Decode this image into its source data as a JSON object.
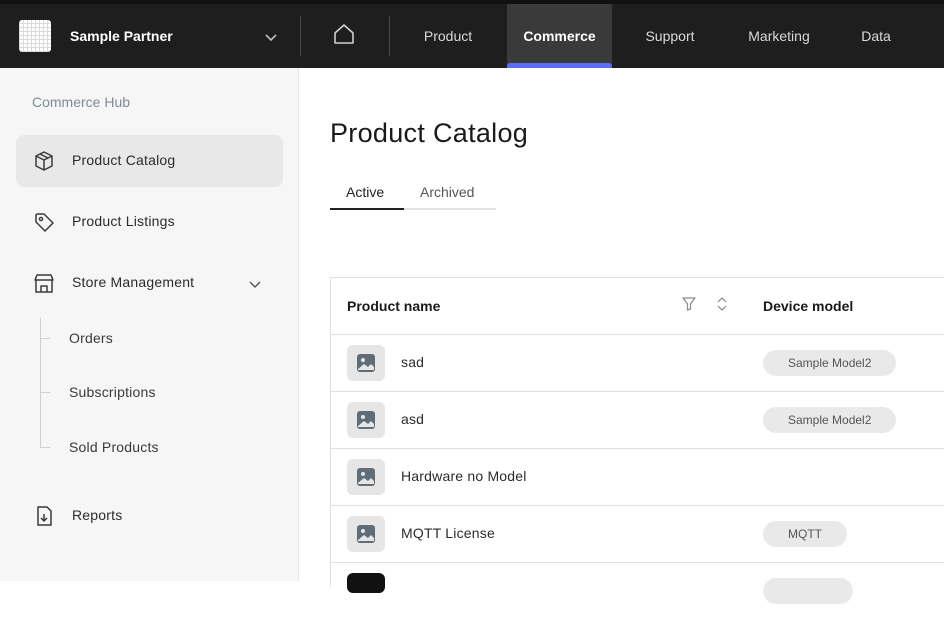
{
  "header": {
    "partner_name": "Sample Partner",
    "nav": [
      {
        "label": "Product",
        "active": false
      },
      {
        "label": "Commerce",
        "active": true
      },
      {
        "label": "Support",
        "active": false
      },
      {
        "label": "Marketing",
        "active": false
      },
      {
        "label": "Data",
        "active": false
      }
    ],
    "accent_color": "#5b6cf5"
  },
  "sidebar": {
    "title": "Commerce Hub",
    "items": [
      {
        "label": "Product Catalog",
        "icon": "box-icon",
        "active": true
      },
      {
        "label": "Product Listings",
        "icon": "tag-icon",
        "active": false
      },
      {
        "label": "Store Management",
        "icon": "store-icon",
        "active": false
      },
      {
        "label": "Reports",
        "icon": "download-report-icon",
        "active": false
      }
    ],
    "store_sub_items": [
      "Orders",
      "Subscriptions",
      "Sold Products"
    ]
  },
  "main": {
    "title": "Product Catalog",
    "tabs": [
      {
        "label": "Active",
        "active": true
      },
      {
        "label": "Archived",
        "active": false
      }
    ],
    "table": {
      "columns": [
        "Product name",
        "Device model"
      ],
      "rows": [
        {
          "name": "sad",
          "device_model": "Sample Model2"
        },
        {
          "name": "asd",
          "device_model": "Sample Model2"
        },
        {
          "name": "Hardware no Model",
          "device_model": ""
        },
        {
          "name": "MQTT License",
          "device_model": "MQTT"
        }
      ]
    }
  }
}
